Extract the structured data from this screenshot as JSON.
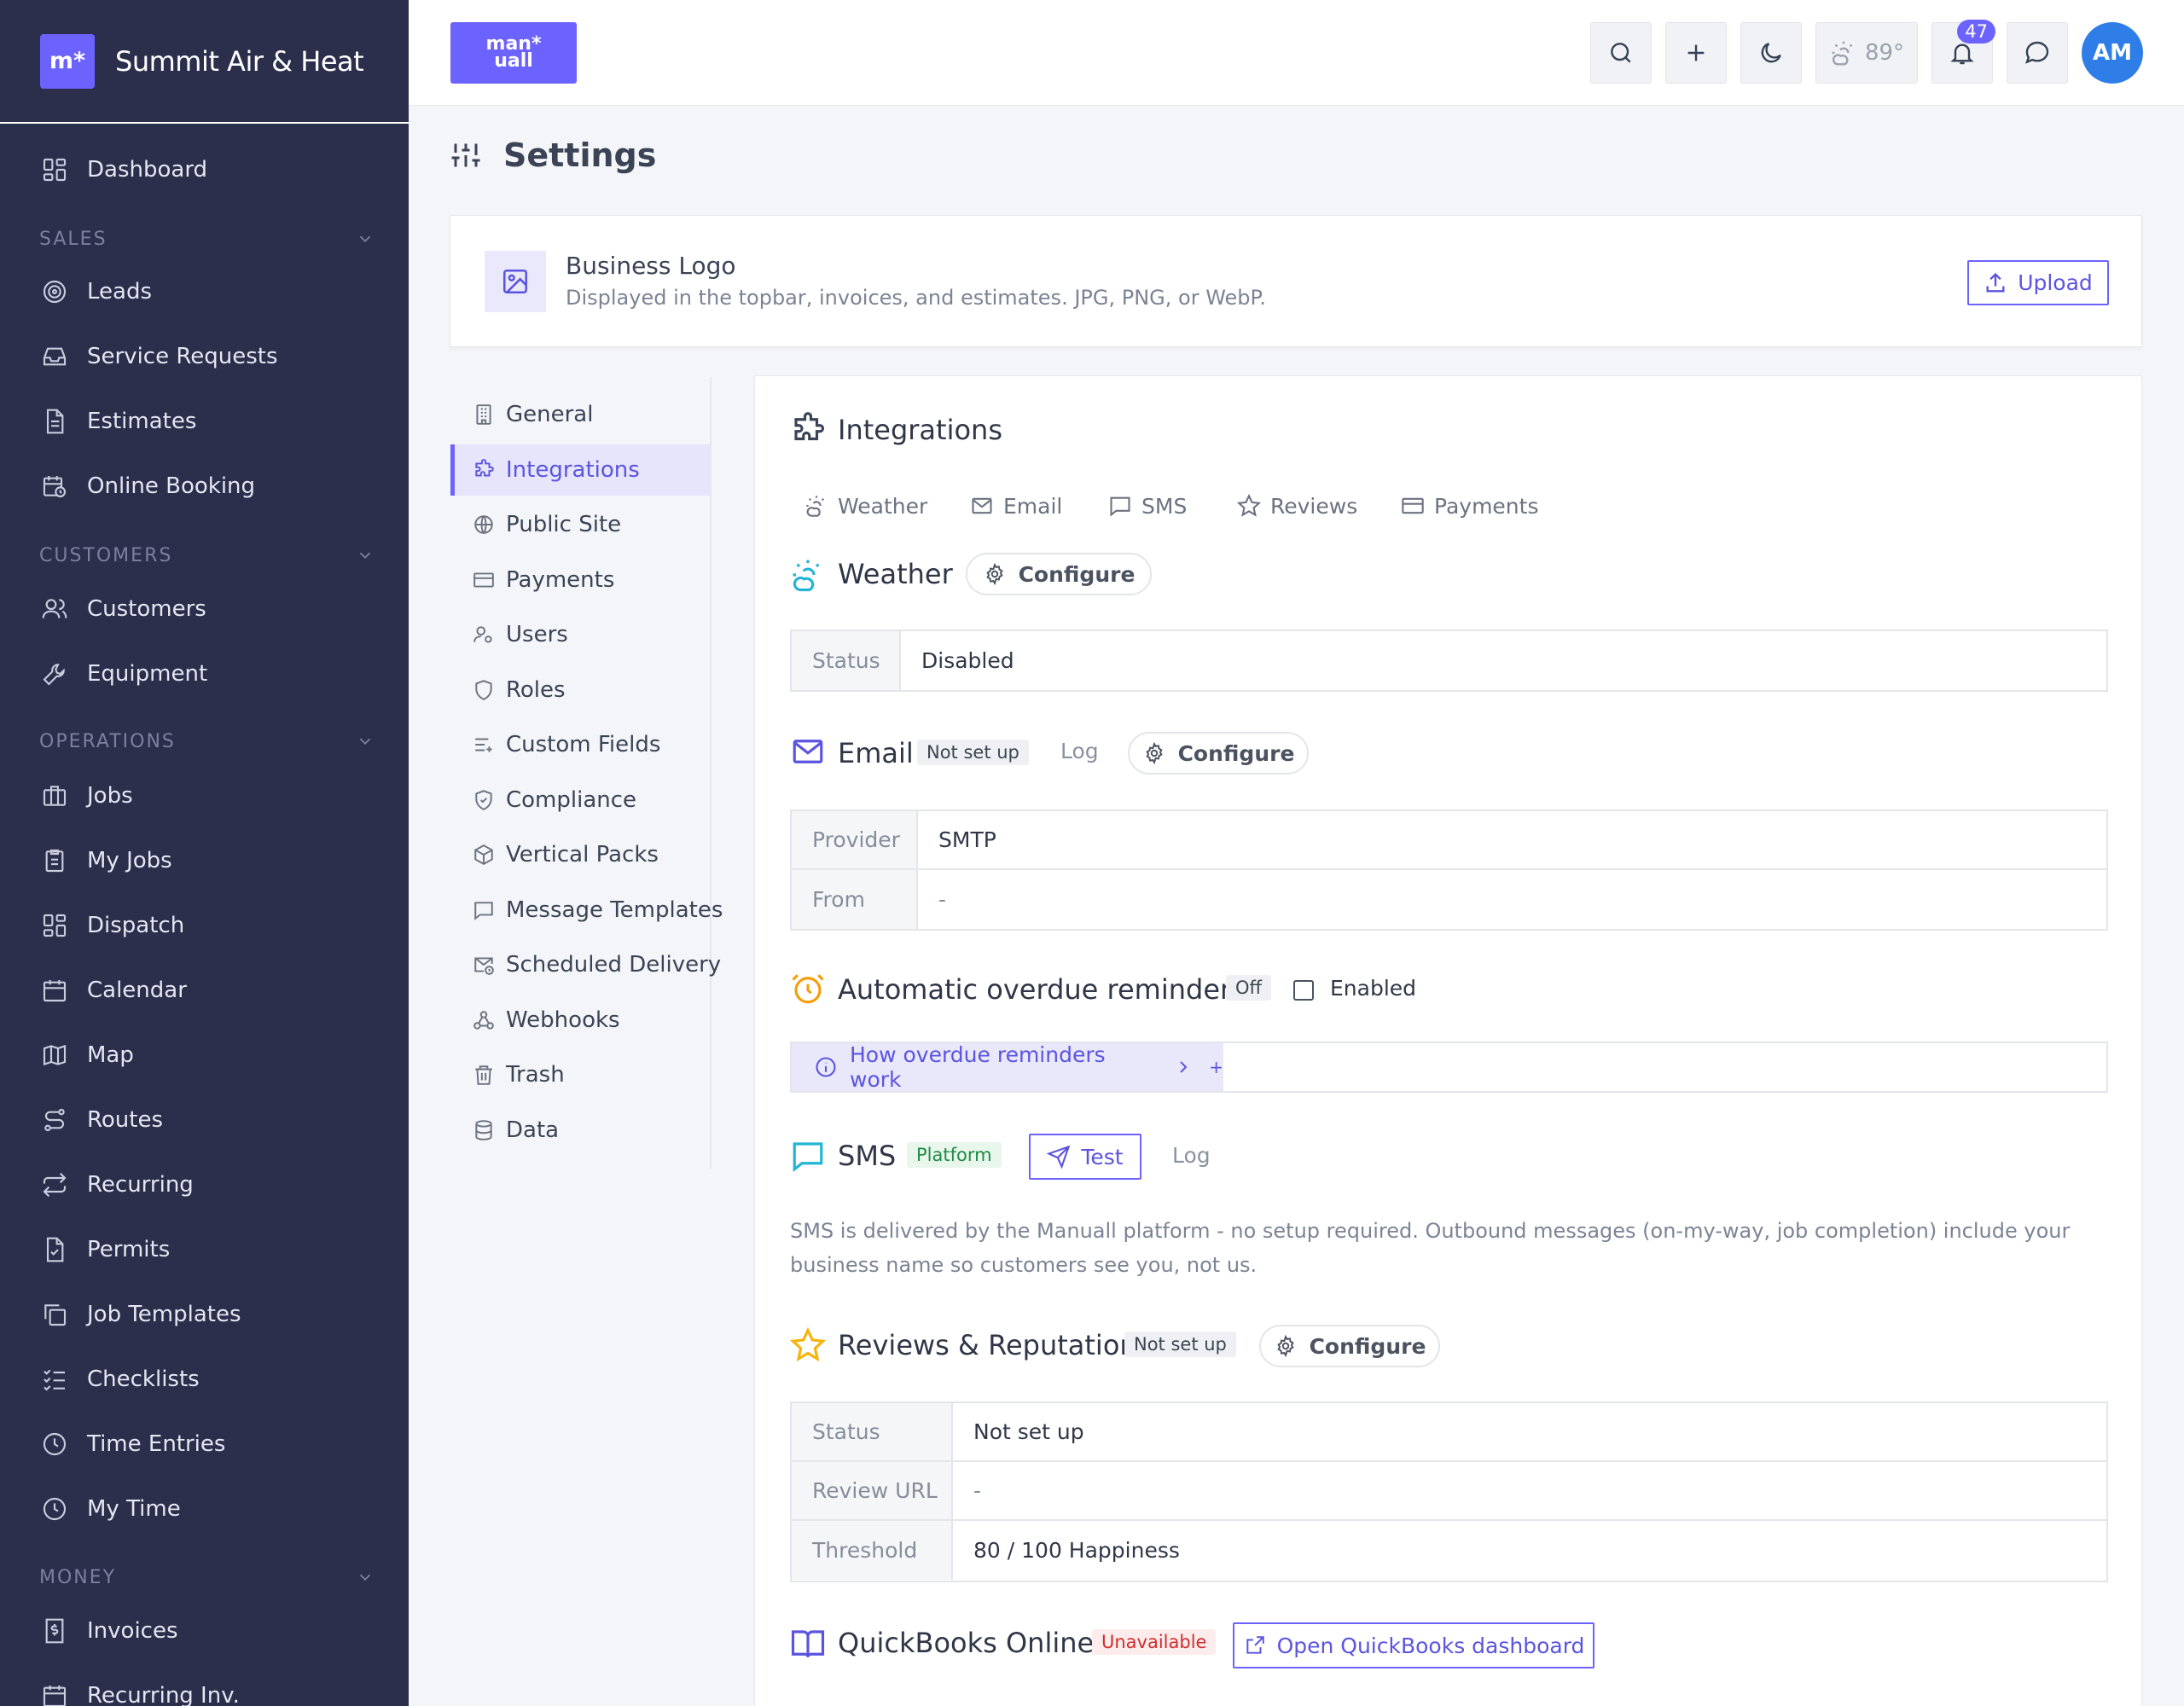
{
  "brand": {
    "logo_text": "m*",
    "name": "Summit Air & Heat"
  },
  "sidebar": {
    "dashboard": "Dashboard",
    "sections": [
      {
        "label": "SALES",
        "items": [
          "Leads",
          "Service Requests",
          "Estimates",
          "Online Booking"
        ]
      },
      {
        "label": "CUSTOMERS",
        "items": [
          "Customers",
          "Equipment"
        ]
      },
      {
        "label": "OPERATIONS",
        "items": [
          "Jobs",
          "My Jobs",
          "Dispatch",
          "Calendar",
          "Map",
          "Routes",
          "Recurring",
          "Permits",
          "Job Templates",
          "Checklists",
          "Time Entries",
          "My Time"
        ]
      },
      {
        "label": "MONEY",
        "items": [
          "Invoices",
          "Recurring Inv."
        ]
      }
    ]
  },
  "topbar": {
    "mark_line1": "man*",
    "mark_line2": "uall",
    "weather": "89°",
    "notifications": "47",
    "avatar": "AM"
  },
  "page": {
    "title": "Settings"
  },
  "logo_card": {
    "title": "Business Logo",
    "description": "Displayed in the topbar, invoices, and estimates. JPG, PNG, or WebP.",
    "upload": "Upload"
  },
  "settings_nav": [
    "General",
    "Integrations",
    "Public Site",
    "Payments",
    "Users",
    "Roles",
    "Custom Fields",
    "Compliance",
    "Vertical Packs",
    "Message Templates",
    "Scheduled Delivery",
    "Webhooks",
    "Trash",
    "Data"
  ],
  "integrations": {
    "title": "Integrations",
    "tabs": [
      "Weather",
      "Email",
      "SMS",
      "Reviews",
      "Payments"
    ],
    "weather": {
      "title": "Weather",
      "configure": "Configure",
      "status_key": "Status",
      "status_val": "Disabled"
    },
    "email": {
      "title": "Email",
      "badge": "Not set up",
      "log": "Log",
      "configure": "Configure",
      "provider_key": "Provider",
      "provider_val": "SMTP",
      "from_key": "From",
      "from_val": "-"
    },
    "reminders": {
      "title": "Automatic overdue reminders",
      "badge": "Off",
      "checkbox_label": "Enabled",
      "howto": "How overdue reminders work",
      "plus": "+"
    },
    "sms": {
      "title": "SMS",
      "badge": "Platform",
      "test": "Test",
      "log": "Log",
      "description": "SMS is delivered by the Manuall platform - no setup required. Outbound messages (on-my-way, job completion) include your business name so customers see you, not us."
    },
    "reviews": {
      "title": "Reviews & Reputation",
      "badge": "Not set up",
      "configure": "Configure",
      "status_key": "Status",
      "status_val": "Not set up",
      "url_key": "Review URL",
      "url_val": "-",
      "threshold_key": "Threshold",
      "threshold_val": "80 / 100 Happiness"
    },
    "quickbooks": {
      "title": "QuickBooks Online",
      "badge": "Unavailable",
      "open": "Open QuickBooks dashboard"
    }
  },
  "colors": {
    "sidebar_bg": "#2b2f4c",
    "accent": "#6c63ff",
    "weather_icon": "#22b5d4",
    "reminder_icon": "#f59e0b",
    "review_icon": "#f5b40b"
  }
}
